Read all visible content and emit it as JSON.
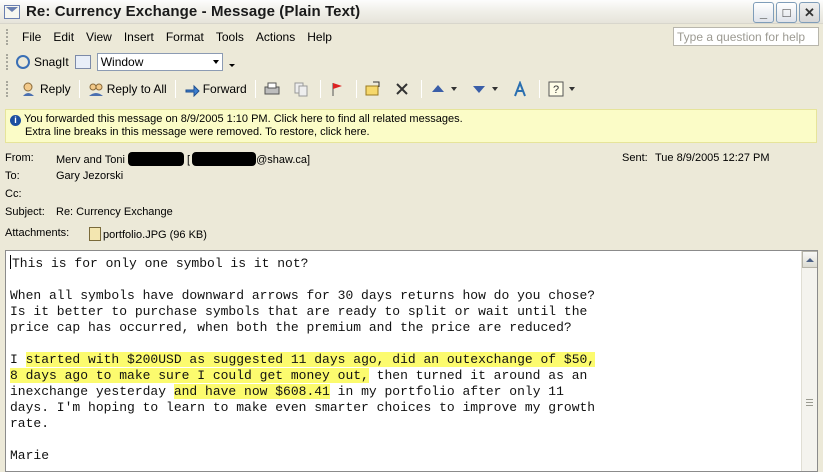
{
  "window": {
    "title": "Re: Currency Exchange - Message (Plain Text)",
    "minimize": "_",
    "maximize": "□",
    "close": "✕"
  },
  "menu": {
    "items": [
      "File",
      "Edit",
      "View",
      "Insert",
      "Format",
      "Tools",
      "Actions",
      "Help"
    ],
    "help_placeholder": "Type a question for help"
  },
  "snagit_toolbar": {
    "snagit_label": "SnagIt",
    "combo_value": "Window"
  },
  "action_toolbar": {
    "reply": "Reply",
    "reply_all": "Reply to All",
    "forward": "Forward"
  },
  "info_bar": {
    "line1": "You forwarded this message on 8/9/2005 1:10 PM. Click here to find all related messages.",
    "line2": "Extra line breaks in this message were removed. To restore, click here."
  },
  "header": {
    "from_label": "From:",
    "from_name": "Merv and Toni",
    "from_domain": "@shaw.ca]",
    "from_bracket": "[",
    "to_label": "To:",
    "to_value": "Gary Jezorski",
    "cc_label": "Cc:",
    "subject_label": "Subject:",
    "subject_value": "Re: Currency Exchange",
    "attachments_label": "Attachments:",
    "attachment_name": "portfolio.JPG (96 KB)",
    "sent_label": "Sent:",
    "sent_value": "Tue 8/9/2005 12:27 PM"
  },
  "message": {
    "l1": "This is for only one symbol is it not?",
    "l3": "When all symbols have downward arrows for 30 days returns how do you chose?",
    "l4": "Is it better to purchase symbols that are ready to split or wait until the",
    "l5": "price cap has occurred, when both the premium and the price are reduced?",
    "l7a": "I ",
    "l7b": "started with $200USD as suggested 11 days ago, did an outexchange of $50,",
    "l8a": "8 days ago to make sure I could get money out,",
    "l8b": " then turned it around as an",
    "l9a": "inexchange yesterday ",
    "l9b": "and have now $608.41",
    "l9c": " in my portfolio after only 11",
    "l10": "days. I'm hoping to learn to make even smarter choices to improve my growth",
    "l11": "rate.",
    "l13": "Marie",
    "highlight_color": "#fcfb6e"
  }
}
